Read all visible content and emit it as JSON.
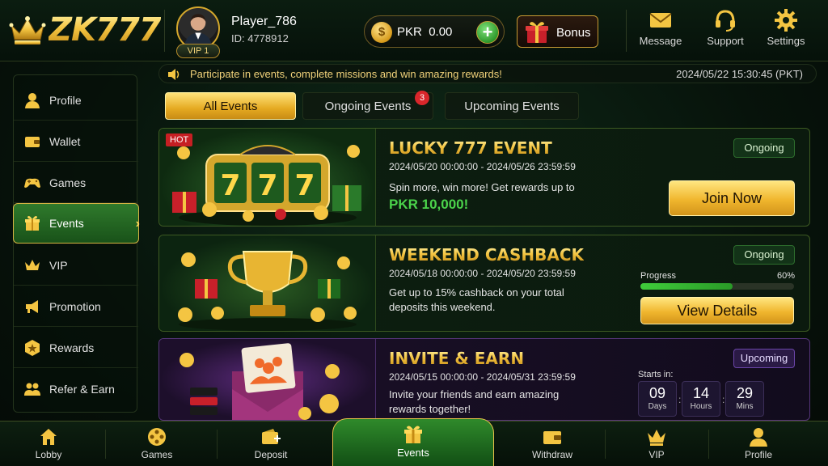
{
  "brand": {
    "name": "ZK777"
  },
  "player": {
    "name": "Player_786",
    "id": "ID: 4778912",
    "vip": "VIP 1"
  },
  "balance": {
    "currency": "PKR",
    "amount": "0.00",
    "coin_symbol": "$",
    "add_symbol": "+"
  },
  "header": {
    "bonus_label": "Bonus",
    "message_label": "Message",
    "support_label": "Support",
    "settings_label": "Settings"
  },
  "sidebar": {
    "items": [
      {
        "label": "Profile",
        "icon": "user-icon"
      },
      {
        "label": "Wallet",
        "icon": "wallet-icon"
      },
      {
        "label": "Games",
        "icon": "gamepad-icon"
      },
      {
        "label": "Events",
        "icon": "gift-icon",
        "active": true
      },
      {
        "label": "VIP",
        "icon": "crown-icon"
      },
      {
        "label": "Promotion",
        "icon": "megaphone-icon"
      },
      {
        "label": "Rewards",
        "icon": "star-badge-icon"
      },
      {
        "label": "Refer & Earn",
        "icon": "people-icon"
      }
    ]
  },
  "announcement": {
    "message": "Participate in events, complete missions and win amazing rewards!",
    "datetime": "2024/05/22   15:30:45 (PKT)"
  },
  "tabs": [
    {
      "label": "All Events",
      "active": true
    },
    {
      "label": "Ongoing Events",
      "badge": "3"
    },
    {
      "label": "Upcoming Events"
    }
  ],
  "events": [
    {
      "tag": "HOT",
      "title": "LUCKY 777 EVENT",
      "dates": "2024/05/20 00:00:00 - 2024/05/26 23:59:59",
      "desc": "Spin more, win more! Get rewards up to",
      "prize": "PKR 10,000!",
      "status": "Ongoing",
      "button": "Join Now"
    },
    {
      "title": "WEEKEND CASHBACK",
      "dates": "2024/05/18 00:00:00 - 2024/05/20 23:59:59",
      "desc": "Get up to 15% cashback on your total deposits this weekend.",
      "status": "Ongoing",
      "progress_label": "Progress",
      "progress_text": "60%",
      "progress_value": 0.6,
      "button": "View Details"
    },
    {
      "title": "INVITE & EARN",
      "dates": "2024/05/15 00:00:00 - 2024/05/31 23:59:59",
      "desc": "Invite your friends and earn amazing rewards together!",
      "status": "Upcoming",
      "starts_in_label": "Starts in:",
      "countdown": [
        {
          "value": "09",
          "unit": "Days"
        },
        {
          "value": "14",
          "unit": "Hours"
        },
        {
          "value": "29",
          "unit": "Mins"
        }
      ]
    }
  ],
  "bottom_nav": [
    {
      "label": "Lobby",
      "icon": "home-icon"
    },
    {
      "label": "Games",
      "icon": "film-reel-icon"
    },
    {
      "label": "Deposit",
      "icon": "wallet-plus-icon"
    },
    {
      "label": "Events",
      "icon": "gift-icon",
      "active": true
    },
    {
      "label": "Withdraw",
      "icon": "wallet-icon"
    },
    {
      "label": "VIP",
      "icon": "crown-icon"
    },
    {
      "label": "Profile",
      "icon": "user-icon"
    }
  ],
  "colors": {
    "gold": "#f4c542",
    "green_accent": "#2f8a2b",
    "background": "#07130b",
    "hot_red": "#c61f23",
    "upcoming_purple": "#6a45a8"
  }
}
